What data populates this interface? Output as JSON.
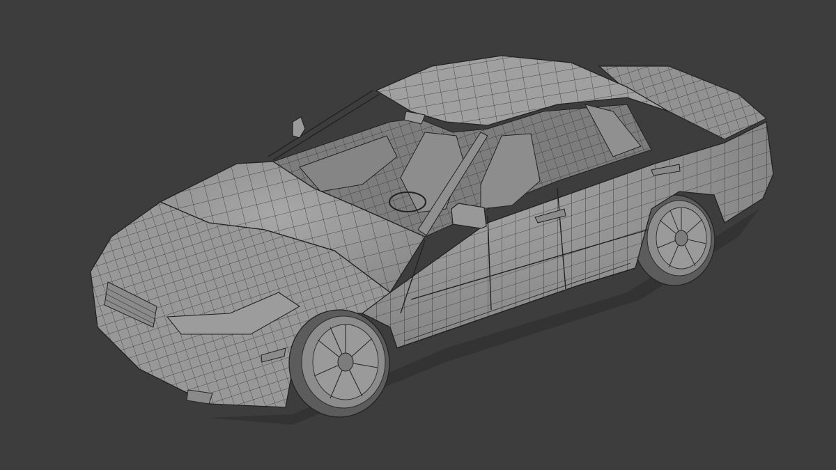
{
  "viewport": {
    "background": "#3d3d3d",
    "object": "car-wireframe-model",
    "shading": "solid",
    "overlay": "wireframe"
  },
  "colors": {
    "body": "#8e8e8e",
    "body_light": "#a4a4a4",
    "body_dark": "#6f6f6f",
    "wire": "#2a2a2a",
    "interior": "#7a7a7a",
    "tire": "#5c5c5c",
    "rim": "#9a9a9a"
  }
}
